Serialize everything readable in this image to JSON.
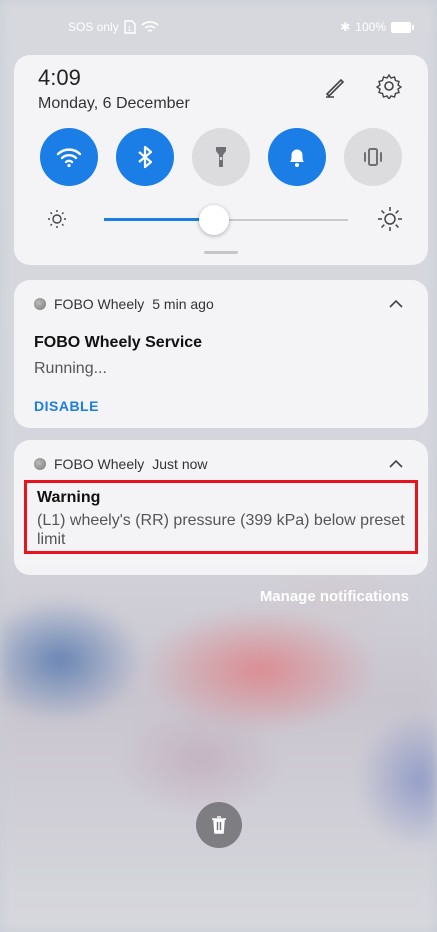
{
  "status_bar": {
    "carrier": "SOS only",
    "bluetooth_glyph": "✱",
    "battery": "100%"
  },
  "quick_settings": {
    "time": "4:09",
    "date": "Monday, 6 December",
    "toggles": [
      {
        "name": "wifi",
        "icon": "wifi-icon",
        "state": "on"
      },
      {
        "name": "bluetooth",
        "icon": "bluetooth-icon",
        "state": "on"
      },
      {
        "name": "flashlight",
        "icon": "flashlight-icon",
        "state": "off"
      },
      {
        "name": "sound",
        "icon": "bell-icon",
        "state": "on"
      },
      {
        "name": "vibrate",
        "icon": "vibrate-icon",
        "state": "off"
      }
    ],
    "brightness": 0.45,
    "accent": "#1a7ee6"
  },
  "notifications": [
    {
      "app": "FOBO Wheely",
      "time": "5 min ago",
      "title": "FOBO Wheely Service",
      "text": "Running...",
      "action": "DISABLE"
    },
    {
      "app": "FOBO Wheely",
      "time": "Just now",
      "title": "Warning",
      "text": "(L1) wheely's (RR) pressure (399 kPa) below preset limit",
      "highlight_color": "#e8141d"
    }
  ],
  "manage_label": "Manage notifications"
}
